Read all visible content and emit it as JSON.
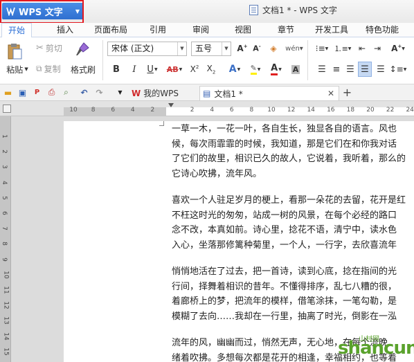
{
  "app": {
    "menu_button_label": "WPS 文字",
    "window_title": "文档1 * - WPS 文字"
  },
  "ribbon_tabs": [
    {
      "label": "开始",
      "active": true
    },
    {
      "label": "插入"
    },
    {
      "label": "页面布局"
    },
    {
      "label": "引用"
    },
    {
      "label": "审阅"
    },
    {
      "label": "视图"
    },
    {
      "label": "章节"
    },
    {
      "label": "开发工具"
    },
    {
      "label": "特色功能"
    }
  ],
  "clipboard": {
    "paste_label": "粘贴",
    "cut_label": "剪切",
    "copy_label": "复制",
    "format_painter_label": "格式刷"
  },
  "font": {
    "family_value": "宋体 (正文)",
    "size_value": "五号"
  },
  "document_tabs": [
    {
      "label": "我的WPS"
    },
    {
      "label": "文档1 *",
      "active": true
    }
  ],
  "ruler": {
    "horizontal_ticks": [
      "10",
      "8",
      "6",
      "4",
      "2",
      "",
      "2",
      "4",
      "6",
      "8",
      "10",
      "12",
      "14",
      "16",
      "18",
      "20",
      "22",
      "24"
    ],
    "vertical_ticks": [
      "1",
      "2",
      "3",
      "4",
      "5",
      "6",
      "7",
      "8",
      "9",
      "10",
      "11",
      "12",
      "13",
      "14",
      "15",
      "16"
    ]
  },
  "document": {
    "paragraphs": [
      [
        "一草一木，一花一叶，各自生长，独显各自的语言。风也",
        "候，每次雨霏霏的时候，我知道，那是它们在和你我对话",
        "了它们的故里，相识已久的故人，它说着，我听着，那么的",
        "它诗心吹拂，流年风。"
      ],
      [
        "喜欢一个人驻足岁月的梗上，看那一朵花的去留，花开是红",
        "不枉这时光的匆匆，站成一树的风景，在每个必经的路口",
        "念不改，本真如前。诗心里，捻花不语，清宁中，读水色",
        "入心，坐落那修篱种菊里，一个人，一行字，去欣喜流年"
      ],
      [
        "悄悄地活在了过去，把一首诗，读到心底，捻在指间的光",
        "行间，择舞着相识的昔年。不懂得排序，乱七八糟的很，",
        "着廊桥上的梦，把流年的模样，借笔涂抹，一笔勾勒，是",
        "模糊了去向……我却在一行里，抽离了时光，倒影在一泓"
      ],
      [
        "流年的风，幽幽而过，悄然无声，无心地，在每个流晚",
        "绪着吹拂。多想每次都是花开的相逢，幸福相约，也等着"
      ]
    ]
  },
  "watermark": {
    "text": "shancun",
    "sub": "山村网"
  }
}
